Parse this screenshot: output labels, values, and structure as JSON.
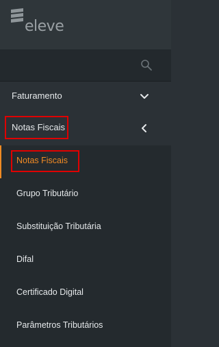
{
  "brand": {
    "name": "eleve"
  },
  "search": {
    "placeholder": ""
  },
  "menu": {
    "faturamento": {
      "label": "Faturamento"
    },
    "notas_fiscais": {
      "label": "Notas Fiscais"
    }
  },
  "submenu": {
    "items": [
      {
        "label": "Notas Fiscais",
        "active": true
      },
      {
        "label": "Grupo Tributário"
      },
      {
        "label": "Substituição Tributária"
      },
      {
        "label": "Difal"
      },
      {
        "label": "Certificado Digital"
      },
      {
        "label": "Parâmetros Tributários"
      }
    ]
  },
  "colors": {
    "accent": "#f08a24",
    "highlight_box": "#e00000",
    "sidebar_bg": "#2b3136",
    "submenu_bg": "#242a2e"
  }
}
